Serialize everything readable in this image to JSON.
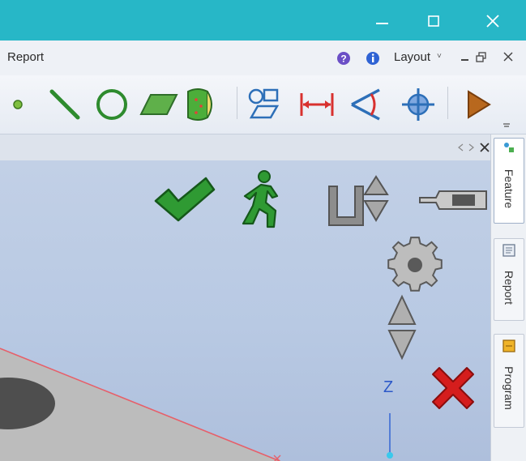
{
  "titlebar": {
    "minimize_icon": "minimize-icon",
    "maximize_icon": "maximize-icon",
    "close_icon": "close-icon",
    "bg_color": "#27b7c7"
  },
  "menubar": {
    "report_label": "Report",
    "layout_label": "Layout",
    "layout_dropdown_glyph": "˅",
    "help_icon": "help-icon",
    "info_icon": "info-icon"
  },
  "toolbar": {
    "tools": [
      "point-tool-icon",
      "line-tool-icon",
      "circle-tool-icon",
      "plane-tool-icon",
      "cylinder-tool-icon",
      "align-tool-icon",
      "distance-tool-icon",
      "angle-tool-icon",
      "position-tool-icon",
      "play-tool-icon"
    ]
  },
  "viewport": {
    "axis_label": "Z",
    "action_icons": [
      "accept-icon",
      "walk-icon",
      "depth-toggle-icon",
      "probe-icon",
      "settings-icon",
      "up-down-icon",
      "cancel-icon"
    ]
  },
  "dock": {
    "tabs": [
      {
        "label": "Feature"
      },
      {
        "label": "Report"
      },
      {
        "label": "Program"
      }
    ]
  }
}
